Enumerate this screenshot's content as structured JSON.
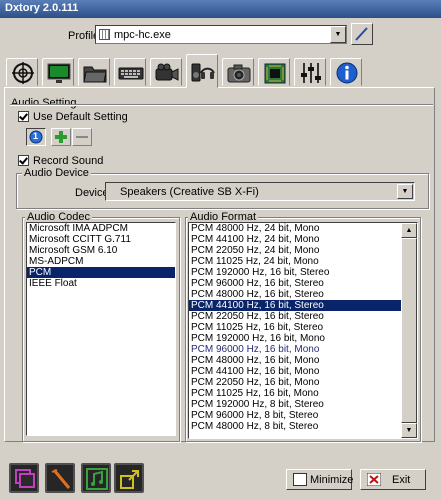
{
  "window": {
    "title": "Dxtory 2.0.111"
  },
  "profile": {
    "label": "Profile",
    "value": "mpc-hc.exe"
  },
  "tabs": [
    {
      "icon": "crosshair-icon"
    },
    {
      "icon": "monitor-icon"
    },
    {
      "icon": "folder-icon"
    },
    {
      "icon": "keyboard-icon"
    },
    {
      "icon": "video-camera-icon"
    },
    {
      "icon": "headphones-speaker-icon",
      "active": true
    },
    {
      "icon": "camera-icon"
    },
    {
      "icon": "chip-icon"
    },
    {
      "icon": "sliders-icon"
    },
    {
      "icon": "info-icon"
    }
  ],
  "audio_setting": {
    "title": "Audio Setting",
    "use_default_label": "Use Default Setting",
    "use_default_checked": true,
    "profile_number": "1",
    "record_sound_label": "Record Sound",
    "record_sound_checked": true
  },
  "audio_device": {
    "title": "Audio Device",
    "device_label": "Device",
    "device_value": "Speakers (Creative SB X-Fi)"
  },
  "audio_codec": {
    "title": "Audio Codec",
    "items": [
      "Microsoft IMA ADPCM",
      "Microsoft CCITT G.711",
      "Microsoft GSM 6.10",
      "MS-ADPCM",
      "PCM",
      "IEEE Float"
    ],
    "selected": "PCM"
  },
  "audio_format": {
    "title": "Audio Format",
    "items": [
      "PCM 48000 Hz, 24 bit, Mono",
      "PCM 44100 Hz, 24 bit, Mono",
      "PCM 22050 Hz, 24 bit, Mono",
      "PCM 11025 Hz, 24 bit, Mono",
      "PCM 192000 Hz, 16 bit, Stereo",
      "PCM 96000 Hz, 16 bit, Stereo",
      "PCM 48000 Hz, 16 bit, Stereo",
      "PCM 44100 Hz, 16 bit, Stereo",
      "PCM 22050 Hz, 16 bit, Stereo",
      "PCM 11025 Hz, 16 bit, Stereo",
      "PCM 192000 Hz, 16 bit, Mono",
      "PCM 96000 Hz, 16 bit, Mono",
      "PCM 48000 Hz, 16 bit, Mono",
      "PCM 44100 Hz, 16 bit, Mono",
      "PCM 22050 Hz, 16 bit, Mono",
      "PCM 11025 Hz, 16 bit, Mono",
      "PCM 192000 Hz, 8 bit, Stereo",
      "PCM 96000 Hz, 8 bit, Stereo",
      "PCM 48000 Hz, 8 bit, Stereo"
    ],
    "selected": "PCM 44100 Hz, 16 bit, Stereo",
    "hovered": "PCM 96000 Hz, 16 bit, Mono"
  },
  "footer": {
    "minimize_label": "Minimize",
    "exit_label": "Exit"
  },
  "colors": {
    "selection": "#0a246a",
    "tab_info_blue": "#1e5fcf",
    "add_green": "#2e9b2e"
  }
}
